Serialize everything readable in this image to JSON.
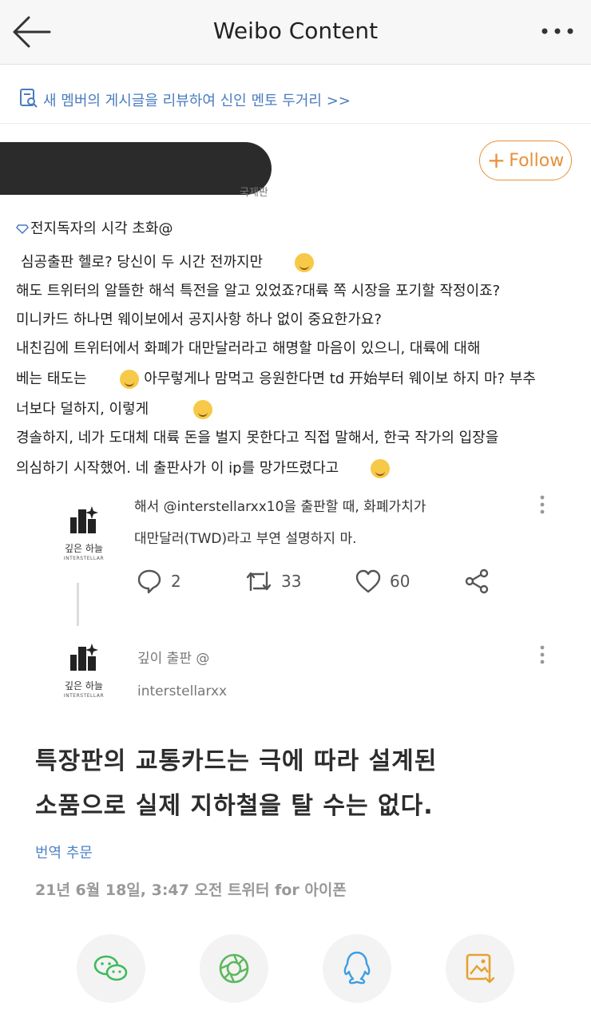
{
  "header": {
    "title": "Weibo Content"
  },
  "review_bar": {
    "text": "새 멤버의 게시글을 리뷰하여 신인 멘토 두거리 >>"
  },
  "author": {
    "sub_label": "국제판"
  },
  "follow_button": {
    "label": "Follow"
  },
  "post": {
    "lines": [
      "전지독자의 시각 초화@",
      "심공출판 헬로? 당신이 두 시간 전까지만",
      "해도 트위터의 알뜰한 해석 특전을 알고 있었죠?대륙 쪽 시장을 포기할 작정이죠?",
      "미니카드 하나면 웨이보에서 공지사항 하나 없이 중요한가요?",
      "내친김에 트위터에서 화폐가 대만달러라고 해명할 마음이 있으니, 대륙에 대해",
      "베는 태도는",
      "아무렇게나 맘먹고 응원한다면 td 开始부터 웨이보 하지 마? 부추",
      "너보다 덜하지, 이렇게",
      "경솔하지, 네가 도대체 대륙 돈을 벌지 못한다고 직접 말해서, 한국 작가의 입장을",
      "의심하기 시작했어. 네 출판사가 이 ip를 망가뜨렸다고"
    ]
  },
  "tweet1": {
    "logo_name": "깊은 하늘",
    "logo_sub": "INTERSTELLAR",
    "line1": "해서 @interstellarxx10을 출판할 때, 화폐가치가",
    "line2": "대만달러(TWD)라고 부연 설명하지 마.",
    "replies": "2",
    "retweets": "33",
    "likes": "60"
  },
  "tweet2": {
    "logo_name": "깊은 하늘",
    "logo_sub": "INTERSTELLAR",
    "name": "깊이 출판 @",
    "handle": "interstellarxx"
  },
  "quote": {
    "line1": "특장판의 교통카드는 극에 따라 설계된",
    "line2": "소품으로 실제 지하철을 탈 수는 없다.",
    "translate_label": "번역 추문",
    "meta": "21년 6월 18일, 3:47 오전 트위터 for 아이폰"
  },
  "share": {
    "icons": [
      "wechat-icon",
      "moments-icon",
      "qq-icon",
      "save-image-icon"
    ],
    "colors": {
      "wechat": "#3fba5a",
      "moments": "#5cb85c",
      "qq": "#3a9ee4",
      "save": "#e8a030"
    }
  },
  "colors": {
    "accent": "#e8903a",
    "link": "#4a7cc0"
  }
}
